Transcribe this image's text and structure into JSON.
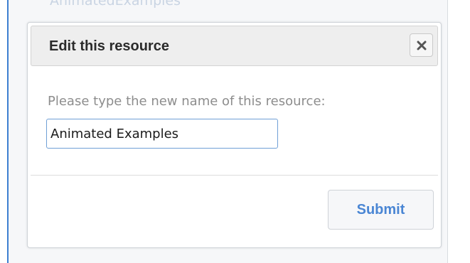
{
  "background": {
    "title": "AnimatedExamples"
  },
  "dialog": {
    "title": "Edit this resource",
    "close_icon": "close-icon",
    "prompt": "Please type the new name of this resource:",
    "input_value": "Animated Examples",
    "submit_label": "Submit"
  },
  "colors": {
    "accent": "#4a86d4",
    "input_border": "#6f9fd6",
    "left_rule": "#3d7fd1",
    "header_bg": "#eeeeee"
  }
}
